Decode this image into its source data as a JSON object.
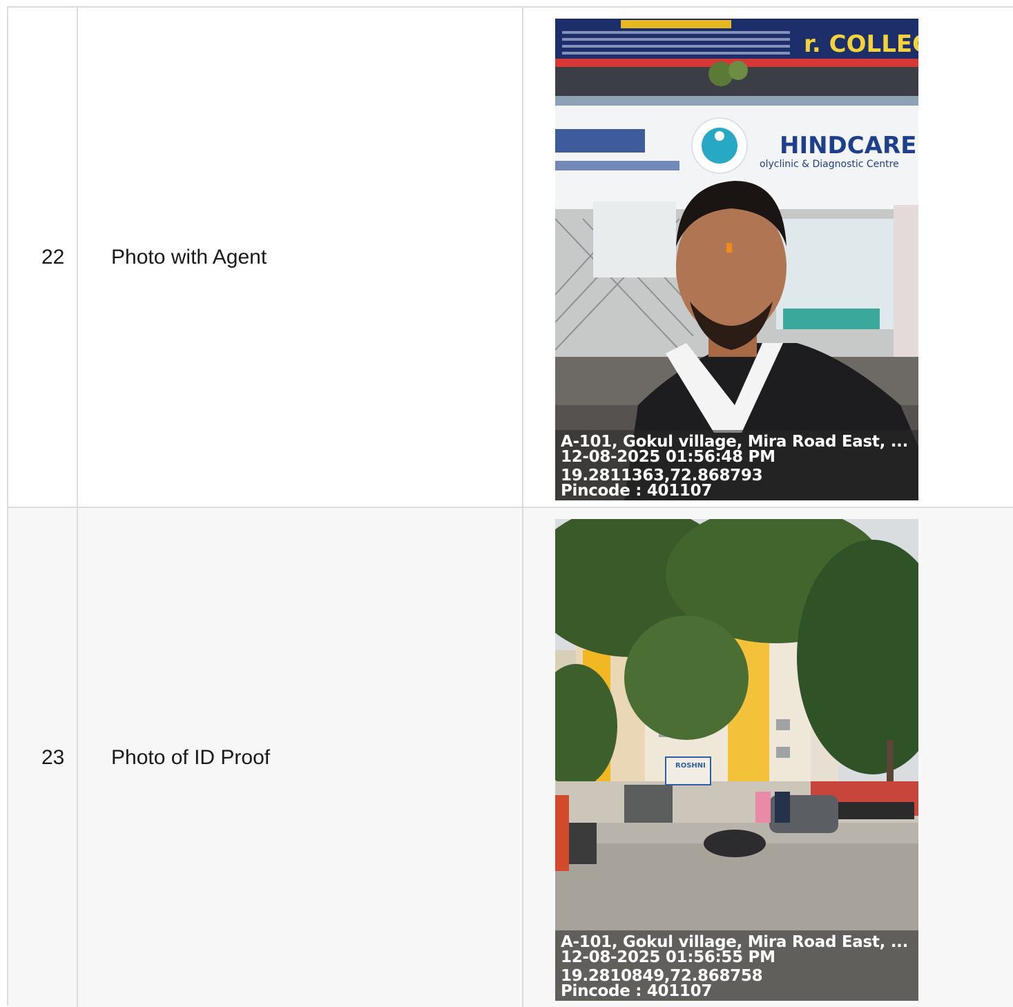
{
  "rows": [
    {
      "number": "22",
      "label": "Photo with Agent",
      "photo": {
        "description": "Selfie of agent outside a building",
        "sign_text_main": "HINDCARE",
        "sign_text_sub": "olyclinic & Diagnostic Centre",
        "banner_text": "r. COLLEGE",
        "overlay": {
          "address": "A-101, Gokul village, Mira Road East, ...",
          "datetime": "12-08-2025 01:56:48 PM",
          "coords": "19.2811363,72.868793",
          "pincode": "Pincode : 401107"
        }
      }
    },
    {
      "number": "23",
      "label": "Photo of ID Proof",
      "photo": {
        "description": "Street view of residential building with trees",
        "sign_text_main": "ROSHNI",
        "overlay": {
          "address": "A-101, Gokul village, Mira Road East, ...",
          "datetime": "12-08-2025 01:56:55 PM",
          "coords": "19.2810849,72.868758",
          "pincode": "Pincode : 401107"
        }
      }
    }
  ]
}
